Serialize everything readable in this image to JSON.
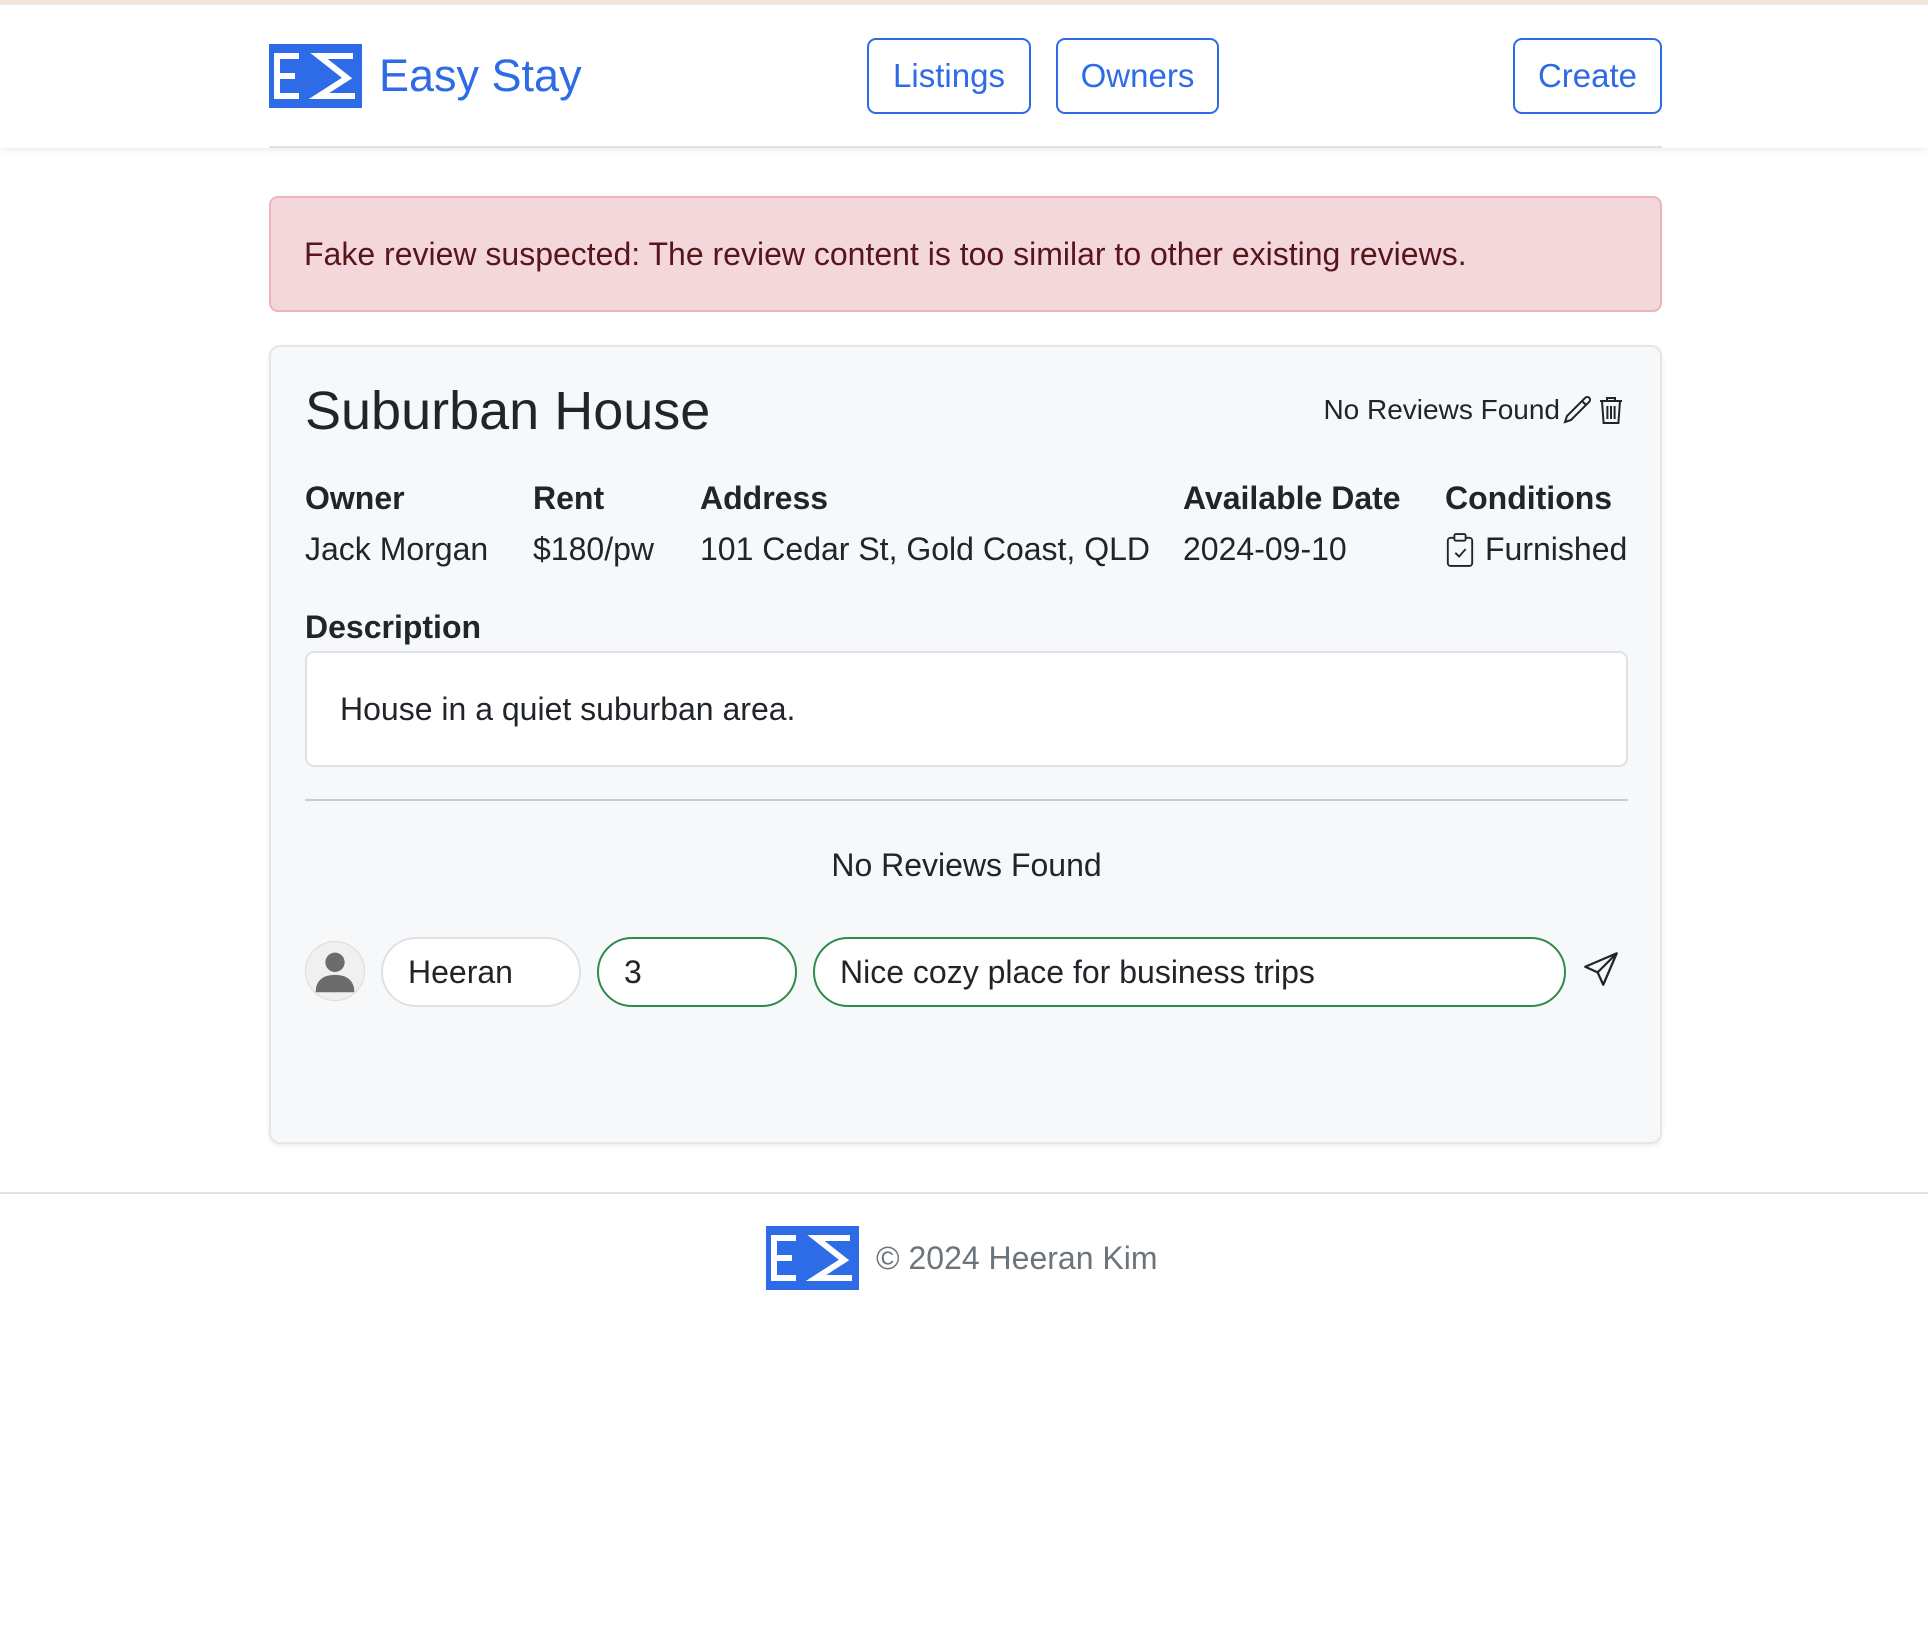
{
  "header": {
    "brand": "Easy Stay",
    "logo_letters": "ES",
    "nav": {
      "listings": "Listings",
      "owners": "Owners",
      "create": "Create"
    }
  },
  "alert": {
    "message": "Fake review suspected: The review content is too similar to other existing reviews."
  },
  "listing": {
    "title": "Suburban House",
    "rating_summary": "No Reviews Found",
    "fields": {
      "owner_label": "Owner",
      "owner": "Jack Morgan",
      "rent_label": "Rent",
      "rent": "$180/pw",
      "address_label": "Address",
      "address": "101 Cedar St, Gold Coast, QLD",
      "date_label": "Available Date",
      "date": "2024-09-10",
      "conditions_label": "Conditions",
      "conditions": "Furnished"
    },
    "description_label": "Description",
    "description": "House in a quiet suburban area."
  },
  "reviews": {
    "empty_message": "No Reviews Found",
    "form": {
      "name_value": "Heeran",
      "rating_value": "3",
      "comment_value": "Nice cozy place for business trips"
    }
  },
  "footer": {
    "copyright": "© 2024 Heeran Kim"
  },
  "icons": {
    "edit": "pencil-icon",
    "delete": "trash-icon",
    "conditions": "clipboard-check-icon",
    "avatar": "person-icon",
    "send": "send-icon"
  },
  "colors": {
    "brand": "#2e6be6",
    "alert_bg": "#f3d7da",
    "alert_text": "#58151c",
    "valid_green": "#2f8a4c"
  }
}
